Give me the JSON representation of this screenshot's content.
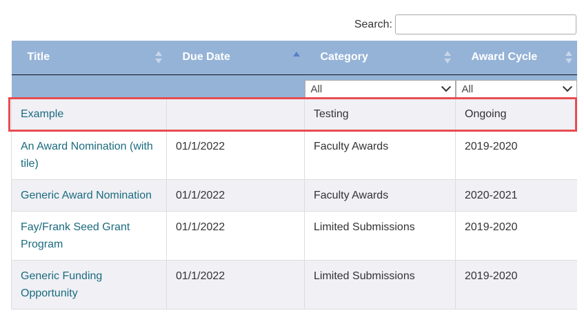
{
  "search": {
    "label": "Search:",
    "value": ""
  },
  "columns": [
    {
      "label": "Title",
      "sort": "none"
    },
    {
      "label": "Due Date",
      "sort": "ascending"
    },
    {
      "label": "Category",
      "sort": "none"
    },
    {
      "label": "Award Cycle",
      "sort": "none"
    }
  ],
  "filters": {
    "category": "All",
    "award_cycle": "All"
  },
  "rows": [
    {
      "title": "Example",
      "due_date": "",
      "category": "Testing",
      "award_cycle": "Ongoing"
    },
    {
      "title": "An Award Nomination (with tile)",
      "due_date": "01/1/2022",
      "category": "Faculty Awards",
      "award_cycle": "2019-2020"
    },
    {
      "title": "Generic Award Nomination",
      "due_date": "01/1/2022",
      "category": "Faculty Awards",
      "award_cycle": "2020-2021"
    },
    {
      "title": "Fay/Frank Seed Grant Program",
      "due_date": "01/1/2022",
      "category": "Limited Submissions",
      "award_cycle": "2019-2020"
    },
    {
      "title": "Generic Funding Opportunity",
      "due_date": "01/1/2022",
      "category": "Limited Submissions",
      "award_cycle": "2019-2020"
    }
  ],
  "colors": {
    "header_bg": "#95b3d7",
    "link": "#1a6b7e",
    "highlight": "#e84b51",
    "stripe": "#f0f0f5"
  }
}
